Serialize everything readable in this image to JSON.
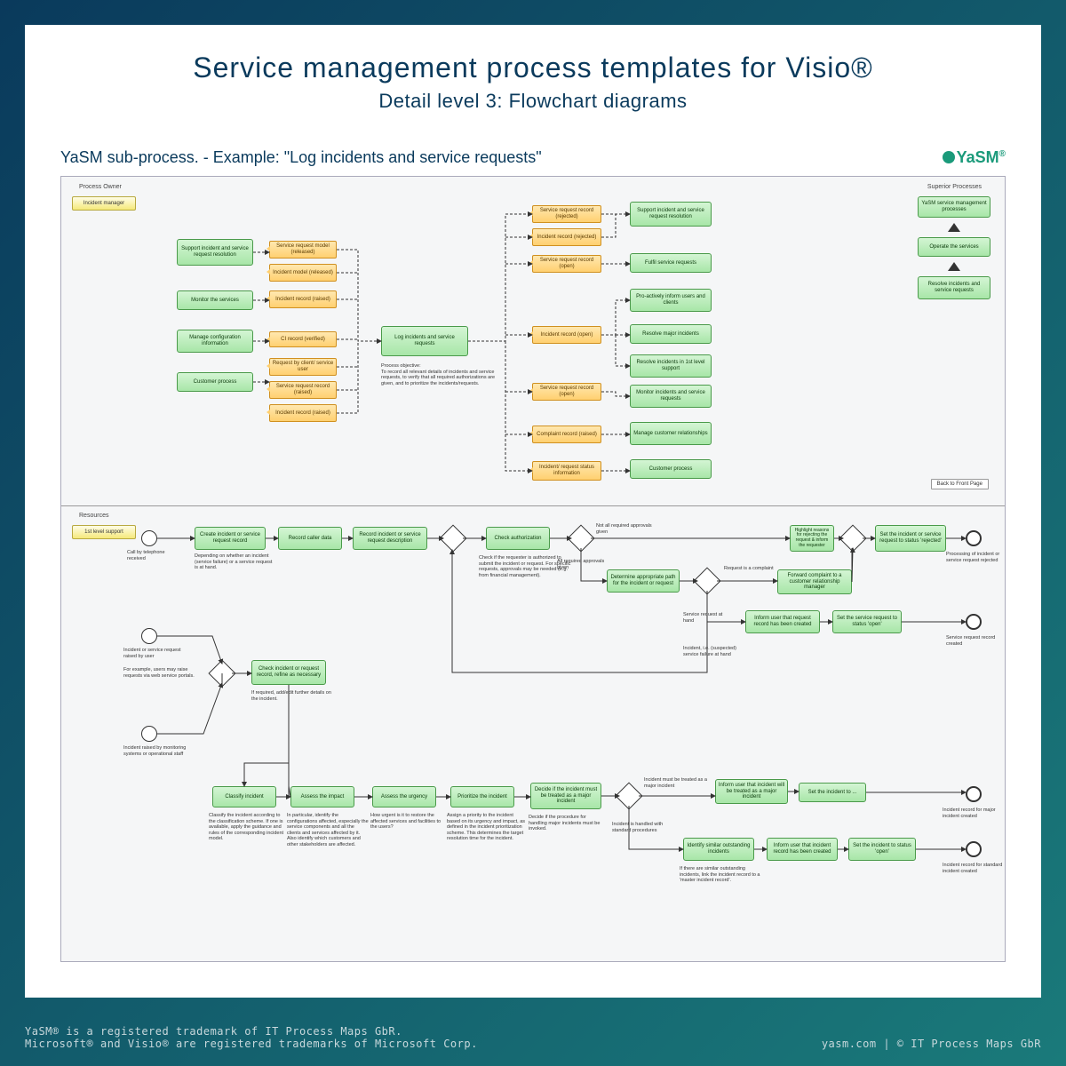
{
  "title": "Service management process templates for Visio®",
  "subtitle": "Detail level 3: Flowchart diagrams",
  "subhead": "YaSM sub-process. - Example: \"Log incidents and service requests\"",
  "logo": "YaSM",
  "footer_left_1": "YaSM® is a registered trademark of IT Process Maps GbR.",
  "footer_left_2": "Microsoft® and Visio® are registered trademarks of Microsoft Corp.",
  "footer_right": "yasm.com | © IT Process Maps GbR",
  "lanes": {
    "owner_label": "Process Owner",
    "owner_role": "Incident manager",
    "resources_label": "Resources",
    "resource_role": "1st level support",
    "superior_label": "Superior Processes"
  },
  "center": {
    "main_box": "Log incidents and service requests",
    "objective": "Process objective:\nTo record all relevant details of incidents and service requests, to verify that all required authorizations are given, and to prioritize the incidents/requests."
  },
  "top_inputs": [
    "Support incident and service request resolution",
    "Monitor the services",
    "Manage configuration information",
    "Customer process"
  ],
  "top_input_artifacts": [
    "Service request model (released)",
    "Incident model (released)",
    "Incident record (raised)",
    "CI record (verified)",
    "Request by client/ service user",
    "Service request record (raised)",
    "Incident record (raised)"
  ],
  "top_output_artifacts": [
    "Service request record (rejected)",
    "Incident record (rejected)",
    "Service request record (open)",
    "Incident record (open)",
    "Service request record (open)",
    "Complaint record (raised)",
    "Incident/ request status information"
  ],
  "top_outputs": [
    "Support incident and service request resolution",
    "Fulfil service requests",
    "Pro-actively inform users and clients",
    "Resolve major incidents",
    "Resolve incidents in 1st level support",
    "Monitor incidents and service requests",
    "Manage customer relationships",
    "Customer process"
  ],
  "superior": [
    "YaSM service management processes",
    "Operate the services",
    "Resolve incidents and service requests"
  ],
  "back_btn": "Back to Front Page",
  "flow": {
    "ev1": "Call by telephone received",
    "ev1a": "Depending on whether an incident (service failure) or a service request is at hand.",
    "ev2": "Incident or service request raised by user",
    "ev2a": "For example, users may raise requests via web service portals.",
    "ev3": "Incident raised by monitoring systems or operational staff",
    "b1": "Create incident or service request record",
    "b2": "Record caller data",
    "b3": "Record incident or service request description",
    "b4": "Check authorization",
    "b4a": "Check if the requester is authorized to submit the incident or request. For specific requests, approvals may be needed (e.g. from financial management).",
    "g1a": "Not all required approvals given",
    "g1b": "All required approvals given",
    "b5": "Determine appropriate path for the incident or request",
    "g2a": "Request is a complaint",
    "b6": "Forward complaint to a customer relationship manager",
    "g2b": "Service request at hand",
    "b7": "Inform user that request record has been created",
    "b8": "Set the service request to status 'open'",
    "g2c": "Incident, i.e. (suspected) service failure at hand",
    "b9": "Highlight reasons for rejecting the request & inform the requester",
    "b10": "Set the incident or service request to status 'rejected'",
    "end1": "Processing of incident or service request rejected",
    "end2": "Service request record created",
    "bchk": "Check incident or request record, refine as necessary",
    "bchka": "If required, add/edit further details on the incident.",
    "c1": "Classify incident",
    "c1a": "Classify the incident according to the classification scheme. If one is available, apply the guidance and rules of the corresponding incident model.",
    "c2": "Assess the impact",
    "c2a": "In particular, identify the configurations affected, especially the service components and all the clients and services affected by it. Also identify which customers and other stakeholders are affected.",
    "c3": "Assess the urgency",
    "c3a": "How urgent is it to restore the affected services and facilities to the users?",
    "c4": "Prioritize the incident",
    "c4a": "Assign a priority to the incident based on its urgency and impact, as defined in the incident prioritization scheme. This determines the target resolution time for the incident.",
    "c5": "Decide if the incident must be treated as a major incident",
    "c5a": "Decide if the procedure for handling major incidents must be invoked.",
    "g3a": "Incident must be treated as a major incident",
    "d1": "Inform user that incident will be treated as a major incident",
    "d2": "Set the incident to ...",
    "end3": "Incident record for major incident created",
    "g3b": "Incident is handled with standard procedures",
    "e1": "Identify similar outstanding incidents",
    "e1a": "If there are similar outstanding incidents, link the incident record to a 'master incident record'.",
    "e2": "Inform user that incident record has been created",
    "e3": "Set the incident to status 'open'",
    "end4": "Incident record for standard incident created"
  }
}
